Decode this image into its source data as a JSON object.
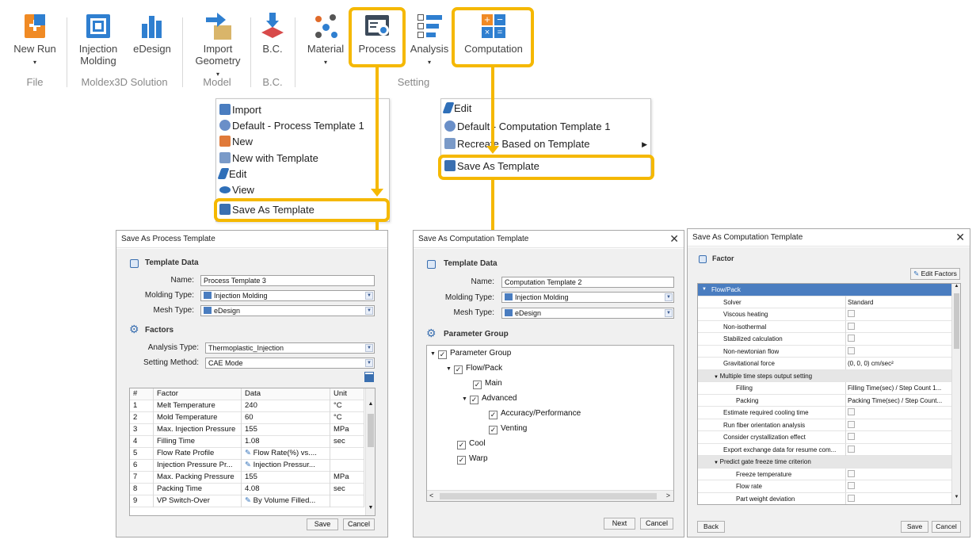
{
  "ribbon": {
    "buttons": [
      {
        "label": "New Run",
        "icon": "new-run-icon"
      },
      {
        "label": "Injection\nMolding",
        "icon": "injection-molding-icon"
      },
      {
        "label": "eDesign",
        "icon": "edesign-icon"
      },
      {
        "label": "Import\nGeometry",
        "icon": "import-geometry-icon"
      },
      {
        "label": "B.C.",
        "icon": "bc-icon"
      },
      {
        "label": "Material",
        "icon": "material-icon"
      },
      {
        "label": "Process",
        "icon": "process-icon"
      },
      {
        "label": "Analysis",
        "icon": "analysis-icon"
      },
      {
        "label": "Computation",
        "icon": "computation-icon"
      }
    ],
    "groups": [
      "File",
      "Moldex3D Solution",
      "Model",
      "B.C.",
      "Setting"
    ],
    "caret": "▾"
  },
  "process_menu": {
    "items": [
      "Import",
      "Default - Process Template 1",
      "New",
      "New with Template",
      "Edit",
      "View",
      "Save As Template"
    ]
  },
  "computation_menu": {
    "items": [
      "Edit",
      "Default - Computation Template 1",
      "Recreate Based on Template",
      "Save As Template"
    ],
    "submenu_arrow": "▶"
  },
  "process_dialog": {
    "title": "Save As Process Template",
    "template_data": "Template Data",
    "name_label": "Name:",
    "name_value": "Process Template 3",
    "molding_type_label": "Molding Type:",
    "molding_type_value": "Injection Molding",
    "mesh_type_label": "Mesh Type:",
    "mesh_type_value": "eDesign",
    "factors": "Factors",
    "analysis_type_label": "Analysis Type:",
    "analysis_type_value": "Thermoplastic_Injection",
    "setting_method_label": "Setting Method:",
    "setting_method_value": "CAE Mode",
    "columns": [
      "#",
      "Factor",
      "Data",
      "Unit"
    ],
    "rows": [
      [
        "1",
        "Melt Temperature",
        "240",
        "°C"
      ],
      [
        "2",
        "Mold Temperature",
        "60",
        "°C"
      ],
      [
        "3",
        "Max. Injection Pressure",
        "155",
        "MPa"
      ],
      [
        "4",
        "Filling Time",
        "1.08",
        "sec"
      ],
      [
        "5",
        "Flow Rate Profile",
        "Flow Rate(%) vs....",
        ""
      ],
      [
        "6",
        "Injection Pressure Pr...",
        "Injection Pressur...",
        ""
      ],
      [
        "7",
        "Max. Packing Pressure",
        "155",
        "MPa"
      ],
      [
        "8",
        "Packing Time",
        "4.08",
        "sec"
      ],
      [
        "9",
        "VP Switch-Over",
        "By Volume Filled...",
        ""
      ]
    ],
    "save": "Save",
    "cancel": "Cancel"
  },
  "computation_dialog": {
    "title": "Save As Computation Template",
    "template_data": "Template Data",
    "name_label": "Name:",
    "name_value": "Computation Template 2",
    "molding_type_label": "Molding Type:",
    "molding_type_value": "Injection Molding",
    "mesh_type_label": "Mesh Type:",
    "mesh_type_value": "eDesign",
    "parameter_group": "Parameter Group",
    "tree": [
      "Parameter Group",
      "Flow/Pack",
      "Main",
      "Advanced",
      "Accuracy/Performance",
      "Venting",
      "Cool",
      "Warp"
    ],
    "next": "Next",
    "cancel": "Cancel"
  },
  "factor_dialog": {
    "title": "Save As Computation Template",
    "factor": "Factor",
    "edit_factors": "Edit Factors",
    "group": "Flow/Pack",
    "rows": [
      {
        "name": "Solver",
        "value": "Standard"
      },
      {
        "name": "Viscous heating",
        "value": ""
      },
      {
        "name": "Non-isothermal",
        "value": ""
      },
      {
        "name": "Stabilized calculation",
        "value": ""
      },
      {
        "name": "Non-newtonian flow",
        "value": ""
      },
      {
        "name": "Gravitational force",
        "value": "(0, 0, 0) cm/sec²"
      },
      {
        "name": "Multiple time steps output setting",
        "value": ""
      },
      {
        "name": "Filling",
        "value": "Filling Time(sec) / Step Count 1..."
      },
      {
        "name": "Packing",
        "value": "Packing Time(sec) / Step Count..."
      },
      {
        "name": "Estimate required cooling time",
        "value": ""
      },
      {
        "name": "Run fiber orientation analysis",
        "value": ""
      },
      {
        "name": "Consider crystallization effect",
        "value": ""
      },
      {
        "name": "Export exchange data for resume com...",
        "value": ""
      },
      {
        "name": "Predict gate freeze time criterion",
        "value": ""
      },
      {
        "name": "Freeze temperature",
        "value": ""
      },
      {
        "name": "Flow rate",
        "value": ""
      },
      {
        "name": "Part weight deviation",
        "value": ""
      }
    ],
    "back": "Back",
    "save": "Save",
    "cancel": "Cancel"
  },
  "colors": {
    "highlight": "#f5b800",
    "accent_blue": "#3a6fb0",
    "group_header": "#4a7dc0"
  }
}
